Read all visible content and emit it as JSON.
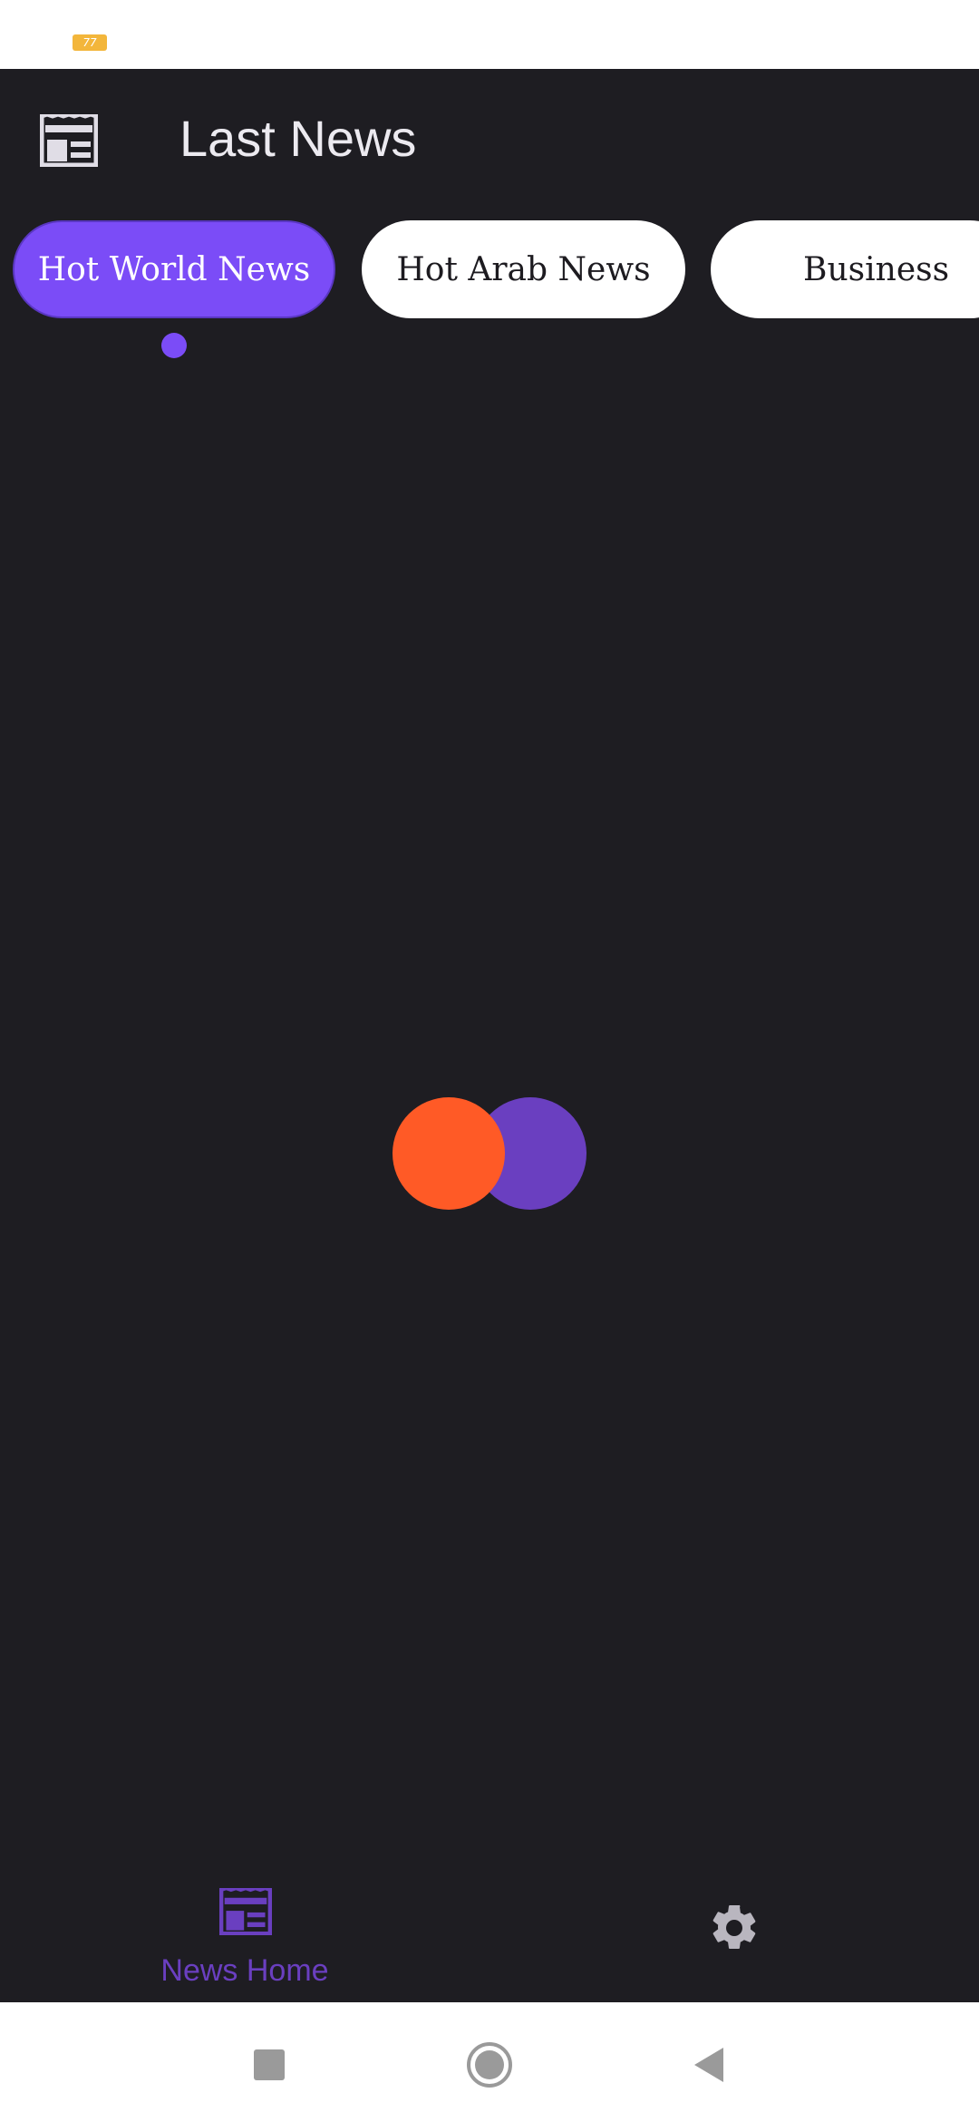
{
  "status_bar": {
    "battery_text": "77"
  },
  "app_bar": {
    "icon": "newspaper-icon",
    "title": "Last News"
  },
  "tabs": [
    {
      "label": "Hot World News",
      "active": true
    },
    {
      "label": "Hot Arab News",
      "active": false
    },
    {
      "label": "Business",
      "active": false
    }
  ],
  "loader": {
    "colors": [
      "#ff5a26",
      "#6a3fc0"
    ]
  },
  "bottom_nav": {
    "home": {
      "icon": "newspaper-icon",
      "label": "News Home",
      "active": true
    },
    "settings": {
      "icon": "gear-icon"
    }
  },
  "system_nav": {
    "buttons": [
      "recents-square-icon",
      "home-circle-icon",
      "back-triangle-icon"
    ]
  },
  "colors": {
    "accent": "#7b4cf7",
    "background": "#1e1d22",
    "loader_orange": "#ff5a26",
    "loader_purple": "#6a3fc0"
  }
}
